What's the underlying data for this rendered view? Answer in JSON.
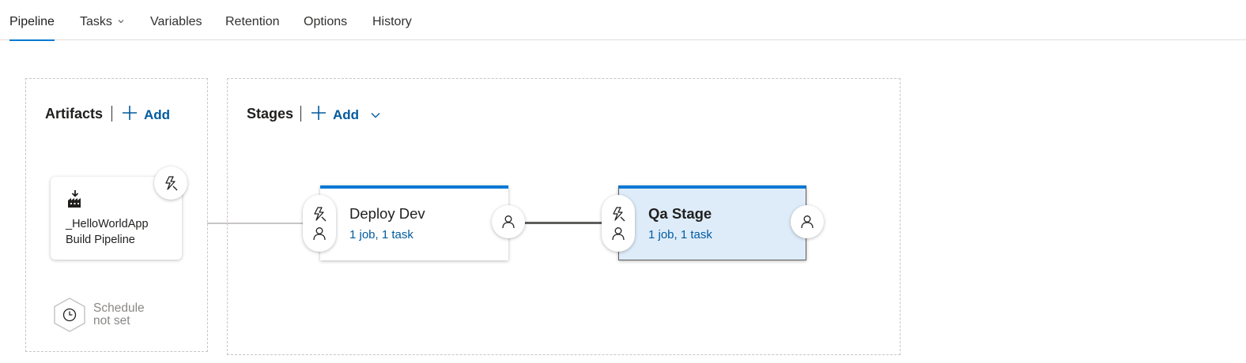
{
  "tabs": [
    {
      "label": "Pipeline",
      "active": true
    },
    {
      "label": "Tasks",
      "has_dropdown": true
    },
    {
      "label": "Variables"
    },
    {
      "label": "Retention"
    },
    {
      "label": "Options"
    },
    {
      "label": "History"
    }
  ],
  "artifacts": {
    "title": "Artifacts",
    "add_label": "Add",
    "card": {
      "name_line1": "_HelloWorldApp",
      "name_line2": "Build Pipeline",
      "icon": "build-pipeline-icon",
      "trigger_icon": "lightning-trigger-icon"
    },
    "schedule": {
      "line1": "Schedule",
      "line2": "not set",
      "icon": "clock-icon"
    }
  },
  "stages": {
    "title": "Stages",
    "add_label": "Add",
    "items": [
      {
        "name": "Deploy Dev",
        "summary": "1 job, 1 task",
        "selected": false
      },
      {
        "name": "Qa Stage",
        "summary": "1 job, 1 task",
        "selected": true
      }
    ]
  },
  "colors": {
    "accent": "#0078d4",
    "link": "#005a9e",
    "selected_bg": "#deecf9",
    "dashed_border": "#c8c6c4"
  }
}
